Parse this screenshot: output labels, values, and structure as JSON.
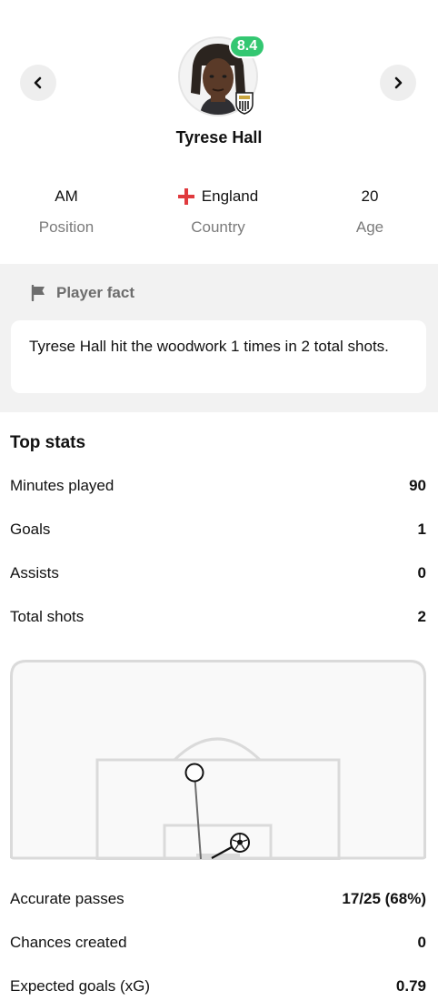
{
  "player": {
    "name": "Tyrese Hall",
    "rating": "8.4",
    "info": [
      {
        "value": "AM",
        "label": "Position"
      },
      {
        "value": "England",
        "label": "Country"
      },
      {
        "value": "20",
        "label": "Age"
      }
    ]
  },
  "colors": {
    "rating_badge": "#33c771",
    "pitch_line": "#dadada",
    "section_bg": "#f2f2f2"
  },
  "icons": {
    "prev": "chevron-left-icon",
    "next": "chevron-right-icon",
    "fact": "flag-icon",
    "country_flag": "england-flag-icon",
    "ball": "football-icon"
  },
  "fact": {
    "title": "Player fact",
    "text": "Tyrese Hall hit the woodwork 1 times in 2 total shots."
  },
  "top_stats": {
    "title": "Top stats",
    "rows": [
      {
        "label": "Minutes played",
        "value": "90"
      },
      {
        "label": "Goals",
        "value": "1"
      },
      {
        "label": "Assists",
        "value": "0"
      },
      {
        "label": "Total shots",
        "value": "2"
      }
    ]
  },
  "more_stats": {
    "rows": [
      {
        "label": "Accurate passes",
        "value": "17/25 (68%)"
      },
      {
        "label": "Chances created",
        "value": "0"
      },
      {
        "label": "Expected goals (xG)",
        "value": "0.79"
      }
    ]
  },
  "shot_map": {
    "shots": [
      {
        "type": "miss",
        "outcome": "woodwork"
      },
      {
        "type": "goal",
        "outcome": "goal"
      }
    ]
  }
}
